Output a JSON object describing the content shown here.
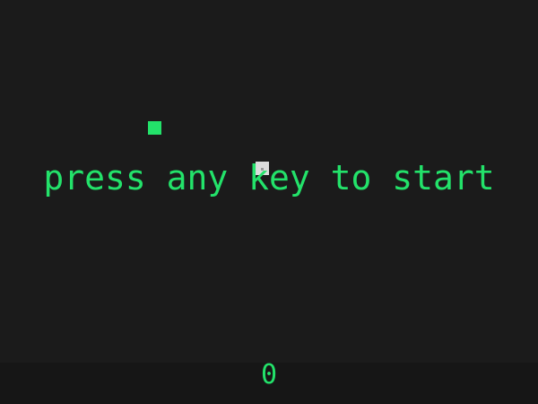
{
  "game": {
    "prompt_text": "press any key to start",
    "score": "0"
  },
  "colors": {
    "background": "#1b1b1b",
    "score_bar": "#161616",
    "accent_green": "#23e26a",
    "snake_head": "#dcdcdc"
  },
  "sprites": {
    "food": "green-square",
    "snake": "white-square-head"
  }
}
